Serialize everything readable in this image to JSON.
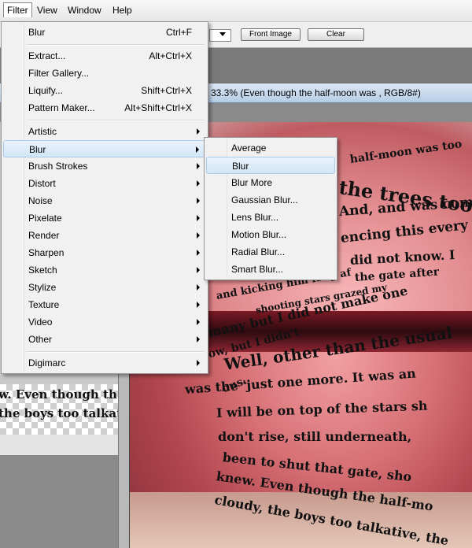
{
  "menubar": {
    "items": [
      "Filter",
      "View",
      "Window",
      "Help"
    ]
  },
  "options": {
    "front_image_label": "Front Image",
    "clear_label": "Clear"
  },
  "document": {
    "title": "33.3% (Even though the half-moon was , RGB/8#)"
  },
  "left_panel": {
    "text_lines": [
      "w.  Even though th",
      "the boys too talkat"
    ]
  },
  "canvas": {
    "text_lines": [
      "half-moon  was too",
      "the trees too ma",
      "And, and was com",
      "encing this every",
      "did not know. I",
      "the gate after",
      "and kicking him long af",
      "shooting stars grazed my",
      "many but I did not make one",
      "now, but I didn't",
      "Well, other than the usual",
      "ous.",
      "was the 'just one more. It was an",
      "I will be on top of the stars sh",
      "don't rise, still underneath,",
      "been to shut that gate, sho",
      "knew. Even though the half-mo",
      "cloudy, the boys too talkative, the"
    ]
  },
  "filter_menu": {
    "items": [
      {
        "label": "Blur",
        "shortcut": "Ctrl+F"
      },
      {
        "label": "Extract...",
        "shortcut": "Alt+Ctrl+X"
      },
      {
        "label": "Filter Gallery...",
        "shortcut": ""
      },
      {
        "label": "Liquify...",
        "shortcut": "Shift+Ctrl+X"
      },
      {
        "label": "Pattern Maker...",
        "shortcut": "Alt+Shift+Ctrl+X"
      },
      {
        "label": "Artistic"
      },
      {
        "label": "Blur"
      },
      {
        "label": "Brush Strokes"
      },
      {
        "label": "Distort"
      },
      {
        "label": "Noise"
      },
      {
        "label": "Pixelate"
      },
      {
        "label": "Render"
      },
      {
        "label": "Sharpen"
      },
      {
        "label": "Sketch"
      },
      {
        "label": "Stylize"
      },
      {
        "label": "Texture"
      },
      {
        "label": "Video"
      },
      {
        "label": "Other"
      },
      {
        "label": "Digimarc"
      }
    ]
  },
  "blur_submenu": {
    "items": [
      "Average",
      "Blur",
      "Blur More",
      "Gaussian Blur...",
      "Lens Blur...",
      "Motion Blur...",
      "Radial Blur...",
      "Smart Blur..."
    ]
  },
  "colors": {
    "highlight": "#d1e6f7",
    "menu_bg": "#f1f1f1"
  }
}
